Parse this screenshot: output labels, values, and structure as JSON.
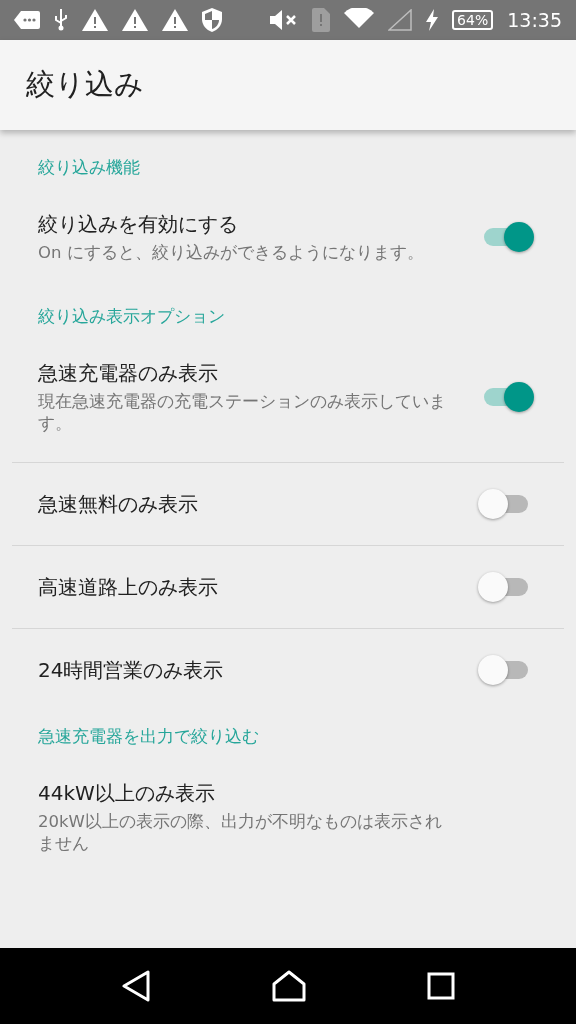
{
  "status_bar": {
    "battery": "64%",
    "time": "13:35"
  },
  "app_bar": {
    "title": "絞り込み"
  },
  "sections": [
    {
      "title": "絞り込み機能",
      "items": [
        {
          "kind": "switch",
          "title": "絞り込みを有効にする",
          "summary": "On にすると、絞り込みができるようになります。",
          "on": true
        }
      ]
    },
    {
      "title": "絞り込み表示オプション",
      "items": [
        {
          "kind": "switch",
          "title": "急速充電器のみ表示",
          "summary": "現在急速充電器の充電ステーションのみ表示しています。",
          "on": true
        },
        {
          "kind": "switch",
          "title": "急速無料のみ表示",
          "on": false
        },
        {
          "kind": "switch",
          "title": "高速道路上のみ表示",
          "on": false
        },
        {
          "kind": "switch",
          "title": "24時間営業のみ表示",
          "on": false
        }
      ]
    },
    {
      "title": "急速充電器を出力で絞り込む",
      "items": [
        {
          "kind": "text",
          "title": "44kW以上のみ表示",
          "summary": "20kW以上の表示の際、出力が不明なものは表示されません"
        }
      ]
    }
  ]
}
